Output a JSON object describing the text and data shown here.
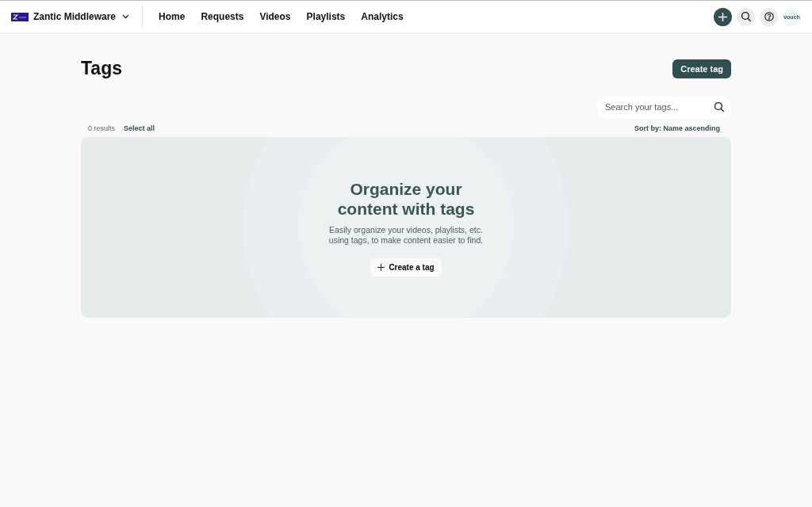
{
  "header": {
    "workspace": "Zantic Middleware",
    "nav": [
      "Home",
      "Requests",
      "Videos",
      "Playlists",
      "Analytics"
    ],
    "avatar": "vouch"
  },
  "page": {
    "title": "Tags",
    "create_button": "Create tag",
    "search": {
      "placeholder": "Search your tags..."
    },
    "results": "0 results",
    "select_all": "Select all",
    "sort": "Sort by: Name ascending"
  },
  "empty_state": {
    "heading": "Organize your content with tags",
    "description": "Easily organize your videos, playlists, etc. using tags, to make content easier to find.",
    "button": "Create a tag"
  }
}
